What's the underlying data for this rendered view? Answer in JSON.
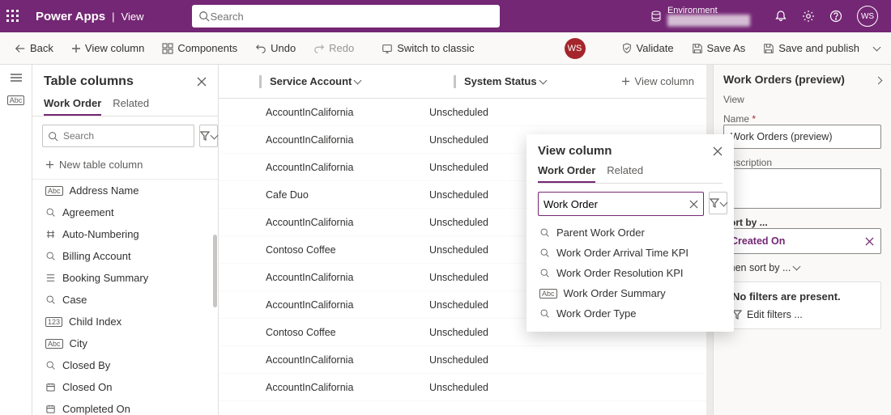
{
  "header": {
    "brand": "Power Apps",
    "section": "View",
    "search_placeholder": "Search",
    "env_label": "Environment",
    "env_name": "████████████",
    "avatar_initials": "WS"
  },
  "commands": {
    "back": "Back",
    "view_column": "View column",
    "components": "Components",
    "undo": "Undo",
    "redo": "Redo",
    "switch_classic": "Switch to classic",
    "validate": "Validate",
    "save_as": "Save As",
    "save_publish": "Save and publish",
    "ws": "WS"
  },
  "leftPanel": {
    "title": "Table columns",
    "tabs": [
      "Work Order",
      "Related"
    ],
    "active_tab": 0,
    "search_placeholder": "Search",
    "new_column": "New table column",
    "columns": [
      {
        "icon": "abc",
        "label": "Address Name"
      },
      {
        "icon": "lookup",
        "label": "Agreement"
      },
      {
        "icon": "hash",
        "label": "Auto-Numbering"
      },
      {
        "icon": "lookup",
        "label": "Billing Account"
      },
      {
        "icon": "list",
        "label": "Booking Summary"
      },
      {
        "icon": "lookup",
        "label": "Case"
      },
      {
        "icon": "123",
        "label": "Child Index"
      },
      {
        "icon": "abc",
        "label": "City"
      },
      {
        "icon": "lookup",
        "label": "Closed By"
      },
      {
        "icon": "cal",
        "label": "Closed On"
      },
      {
        "icon": "cal",
        "label": "Completed On"
      }
    ]
  },
  "grid": {
    "headers": [
      "Service Account",
      "System Status"
    ],
    "view_column_btn": "View column",
    "rows": [
      {
        "acct": "AccountInCalifornia",
        "status": "Unscheduled"
      },
      {
        "acct": "AccountInCalifornia",
        "status": "Unscheduled"
      },
      {
        "acct": "AccountInCalifornia",
        "status": "Unscheduled"
      },
      {
        "acct": "Cafe Duo",
        "status": "Unscheduled"
      },
      {
        "acct": "AccountInCalifornia",
        "status": "Unscheduled"
      },
      {
        "acct": "Contoso Coffee",
        "status": "Unscheduled"
      },
      {
        "acct": "AccountInCalifornia",
        "status": "Unscheduled"
      },
      {
        "acct": "AccountInCalifornia",
        "status": "Unscheduled"
      },
      {
        "acct": "Contoso Coffee",
        "status": "Unscheduled"
      },
      {
        "acct": "AccountInCalifornia",
        "status": "Unscheduled"
      },
      {
        "acct": "AccountInCalifornia",
        "status": "Unscheduled"
      }
    ]
  },
  "popover": {
    "title": "View column",
    "tabs": [
      "Work Order",
      "Related"
    ],
    "active_tab": 0,
    "search_value": "Work Order",
    "results": [
      {
        "icon": "lookup",
        "label": "Parent Work Order"
      },
      {
        "icon": "lookup",
        "label": "Work Order Arrival Time KPI"
      },
      {
        "icon": "lookup",
        "label": "Work Order Resolution KPI"
      },
      {
        "icon": "abc",
        "label": "Work Order Summary"
      },
      {
        "icon": "lookup",
        "label": "Work Order Type"
      }
    ]
  },
  "rightPanel": {
    "title": "Work Orders (preview)",
    "view_tab": "View",
    "name_label": "Name",
    "name_value": "Work Orders (preview)",
    "desc_label": "Description",
    "sort_label": "Sort by ...",
    "sort_value": "Created On",
    "then_sort": "Then sort by ...",
    "no_filters": "No filters are present.",
    "edit_filters": "Edit filters ..."
  }
}
